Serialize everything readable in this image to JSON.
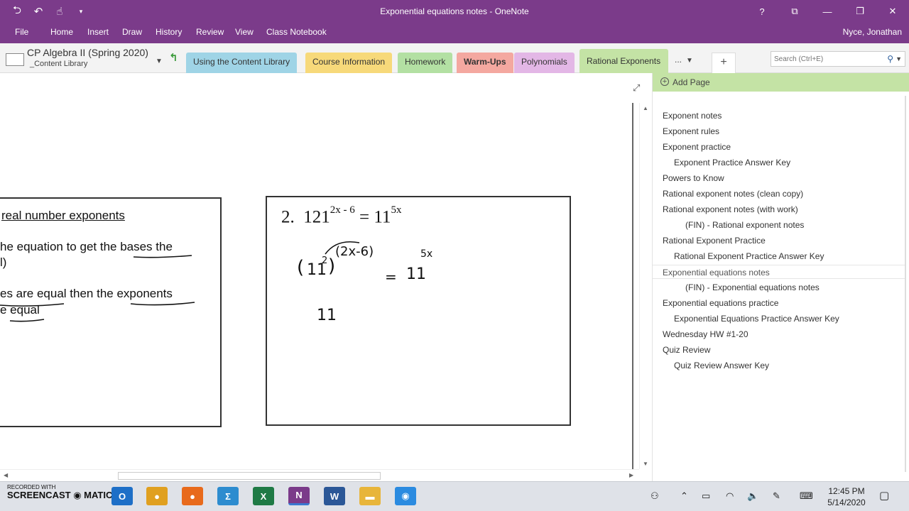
{
  "window": {
    "title": "Exponential equations notes - OneNote",
    "help_label": "?"
  },
  "quick_access": [
    "back-icon",
    "undo-icon",
    "touch-mode-icon",
    "customize-icon"
  ],
  "menu": {
    "items": [
      "File",
      "Home",
      "Insert",
      "Draw",
      "History",
      "Review",
      "View",
      "Class Notebook"
    ],
    "user": "Nyce, Jonathan"
  },
  "notebook": {
    "title": "CP Algebra II (Spring 2020)",
    "section_group": "_Content Library"
  },
  "sections": [
    {
      "label": "Using the Content Library",
      "color": "#9fd4e6"
    },
    {
      "label": "Course Information",
      "color": "#f7d97a"
    },
    {
      "label": "Homework",
      "color": "#b3e0a3"
    },
    {
      "label": "Warm-Ups",
      "color": "#f4a8a0"
    },
    {
      "label": "Polynomials",
      "color": "#e3b7e6"
    },
    {
      "label": "Rational Exponents",
      "color": "#c4e3a5",
      "active": true
    }
  ],
  "section_overflow": "...",
  "search": {
    "placeholder": "Search (Ctrl+E)"
  },
  "note": {
    "left_box": {
      "line1": "real number exponents",
      "line2": "he equation to get the bases the",
      "line3": "l)",
      "line4": "es are equal then the exponents",
      "line5": "e equal"
    },
    "right_box": {
      "problem_number": "2.",
      "equation_lhs_base": "121",
      "equation_lhs_exp": "2x - 6",
      "equation_eq": "=",
      "equation_rhs_base": "11",
      "equation_rhs_exp": "5x",
      "work_inner_exp": "2",
      "work_outer_exp": "(2x-6)",
      "work_base": "11",
      "work_rhs_base": "11",
      "work_rhs_exp": "5x",
      "work_next_line": "11"
    }
  },
  "pages_pane": {
    "add_page": "Add Page",
    "pages": [
      {
        "title": "Exponent notes",
        "level": 0
      },
      {
        "title": "Exponent rules",
        "level": 0
      },
      {
        "title": "Exponent practice",
        "level": 0
      },
      {
        "title": "Exponent Practice Answer Key",
        "level": 1
      },
      {
        "title": "Powers to Know",
        "level": 0
      },
      {
        "title": "Rational exponent notes (clean copy)",
        "level": 0
      },
      {
        "title": "Rational exponent notes (with work)",
        "level": 0
      },
      {
        "title": "(FIN)  -  Rational exponent notes",
        "level": 2
      },
      {
        "title": "Rational Exponent Practice",
        "level": 0
      },
      {
        "title": "Rational Exponent Practice Answer Key",
        "level": 1
      },
      {
        "title": "Exponential equations notes",
        "level": 0,
        "selected": true
      },
      {
        "title": "(FIN) - Exponential equations notes",
        "level": 2
      },
      {
        "title": "Exponential  equations practice",
        "level": 0
      },
      {
        "title": "Exponential Equations Practice Answer Key",
        "level": 1
      },
      {
        "title": "Wednesday HW #1-20",
        "level": 0
      },
      {
        "title": "Quiz Review",
        "level": 0
      },
      {
        "title": "Quiz Review Answer Key",
        "level": 1
      }
    ]
  },
  "taskbar": {
    "recorder_line1": "RECORDED WITH",
    "recorder_line2": "SCREENCAST",
    "recorder_line3": "MATIC",
    "apps": [
      {
        "name": "outlook",
        "glyph": "O",
        "color": "#1e6fc7"
      },
      {
        "name": "chrome",
        "glyph": "●",
        "color": "#e0a020"
      },
      {
        "name": "firefox",
        "glyph": "●",
        "color": "#e86a1c"
      },
      {
        "name": "sway",
        "glyph": "Σ",
        "color": "#2d8ccf"
      },
      {
        "name": "excel",
        "glyph": "X",
        "color": "#1f7a45"
      },
      {
        "name": "onenote",
        "glyph": "N",
        "color": "#7b3b8a"
      },
      {
        "name": "word",
        "glyph": "W",
        "color": "#2b5797"
      },
      {
        "name": "file-explorer",
        "glyph": "▬",
        "color": "#e8b53a"
      },
      {
        "name": "screencast",
        "glyph": "◉",
        "color": "#2b8be0"
      }
    ],
    "time": "12:45 PM",
    "date": "5/14/2020"
  }
}
